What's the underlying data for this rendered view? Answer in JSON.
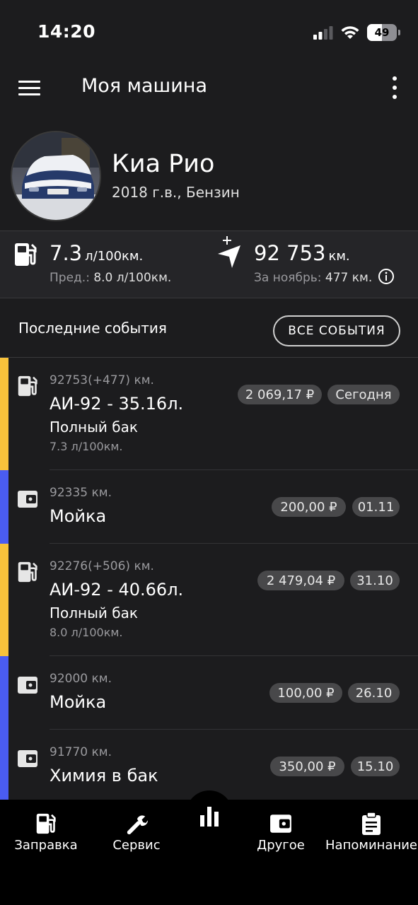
{
  "status_bar": {
    "time": "14:20",
    "battery": "49"
  },
  "app_bar": {
    "title": "Моя машина"
  },
  "car": {
    "name": "Киа Рио",
    "details": "2018 г.в., Бензин"
  },
  "stats": {
    "consumption_value": "7.3",
    "consumption_unit": "л/100км.",
    "consumption_prev_label": "Пред.:",
    "consumption_prev_value": "8.0 л/100км.",
    "odometer_value": "92 753",
    "odometer_unit": "км.",
    "month_label": "За ноябрь:",
    "month_value": "477 км."
  },
  "events_header": {
    "title": "Последние события",
    "all_button": "ВСЕ СОБЫТИЯ"
  },
  "events": [
    {
      "type": "fuel",
      "odometer": "92753(+477) км.",
      "title": "АИ-92 - 35.16л.",
      "note": "Полный бак",
      "consumption": "7.3 л/100км.",
      "amount": "2 069,17 ₽",
      "date": "Сегодня"
    },
    {
      "type": "other",
      "odometer": "92335 км.",
      "title": "Мойка",
      "amount": "200,00 ₽",
      "date": "01.11"
    },
    {
      "type": "fuel",
      "odometer": "92276(+506) км.",
      "title": "АИ-92 - 40.66л.",
      "note": "Полный бак",
      "consumption": "8.0 л/100км.",
      "amount": "2 479,04 ₽",
      "date": "31.10"
    },
    {
      "type": "other",
      "odometer": "92000 км.",
      "title": "Мойка",
      "amount": "100,00 ₽",
      "date": "26.10"
    },
    {
      "type": "other",
      "odometer": "91770 км.",
      "title": "Химия в бак",
      "amount": "350,00 ₽",
      "date": "15.10"
    }
  ],
  "bottom_nav": [
    {
      "label": "Заправка",
      "icon": "fuel-pump-icon"
    },
    {
      "label": "Сервис",
      "icon": "wrench-icon"
    },
    {
      "label": "",
      "icon": "bar-chart-icon"
    },
    {
      "label": "Другое",
      "icon": "wallet-icon"
    },
    {
      "label": "Напоминание",
      "icon": "clipboard-icon"
    }
  ],
  "colors": {
    "fuel_accent": "#f7c23b",
    "other_accent": "#4a5cf2",
    "background": "#1c1c1e",
    "chip": "#48484a"
  }
}
